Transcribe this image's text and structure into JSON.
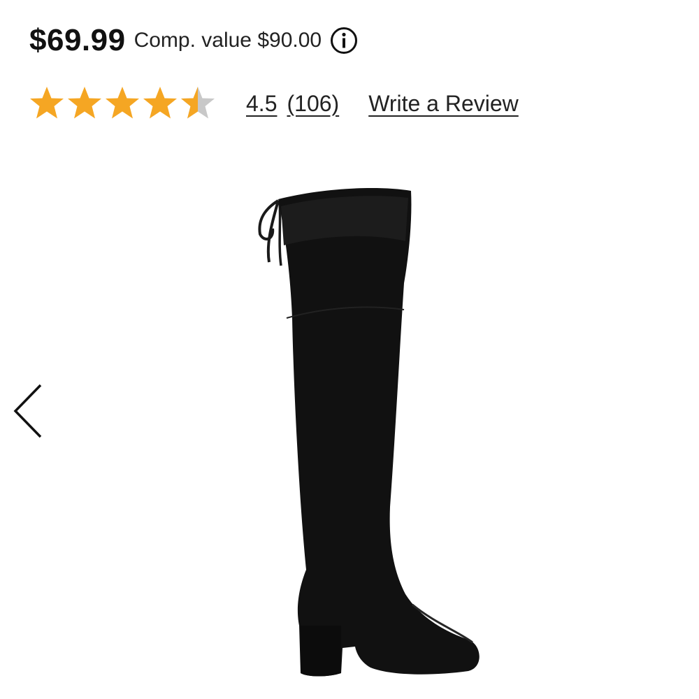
{
  "product": {
    "price": "$69.99",
    "comp_value": "Comp. value $90.00",
    "info_icon": "info-icon",
    "image_alt": "black over-the-knee suede boot",
    "image_subject": "boot-image"
  },
  "rating": {
    "stars_filled": 4.5,
    "stars_total": 5,
    "star_color": "#F5A623",
    "star_empty_color": "#C8C8C8",
    "value": "4.5",
    "count": "(106)",
    "write_review": "Write a Review"
  },
  "carousel": {
    "prev_icon": "chevron-left-icon"
  }
}
